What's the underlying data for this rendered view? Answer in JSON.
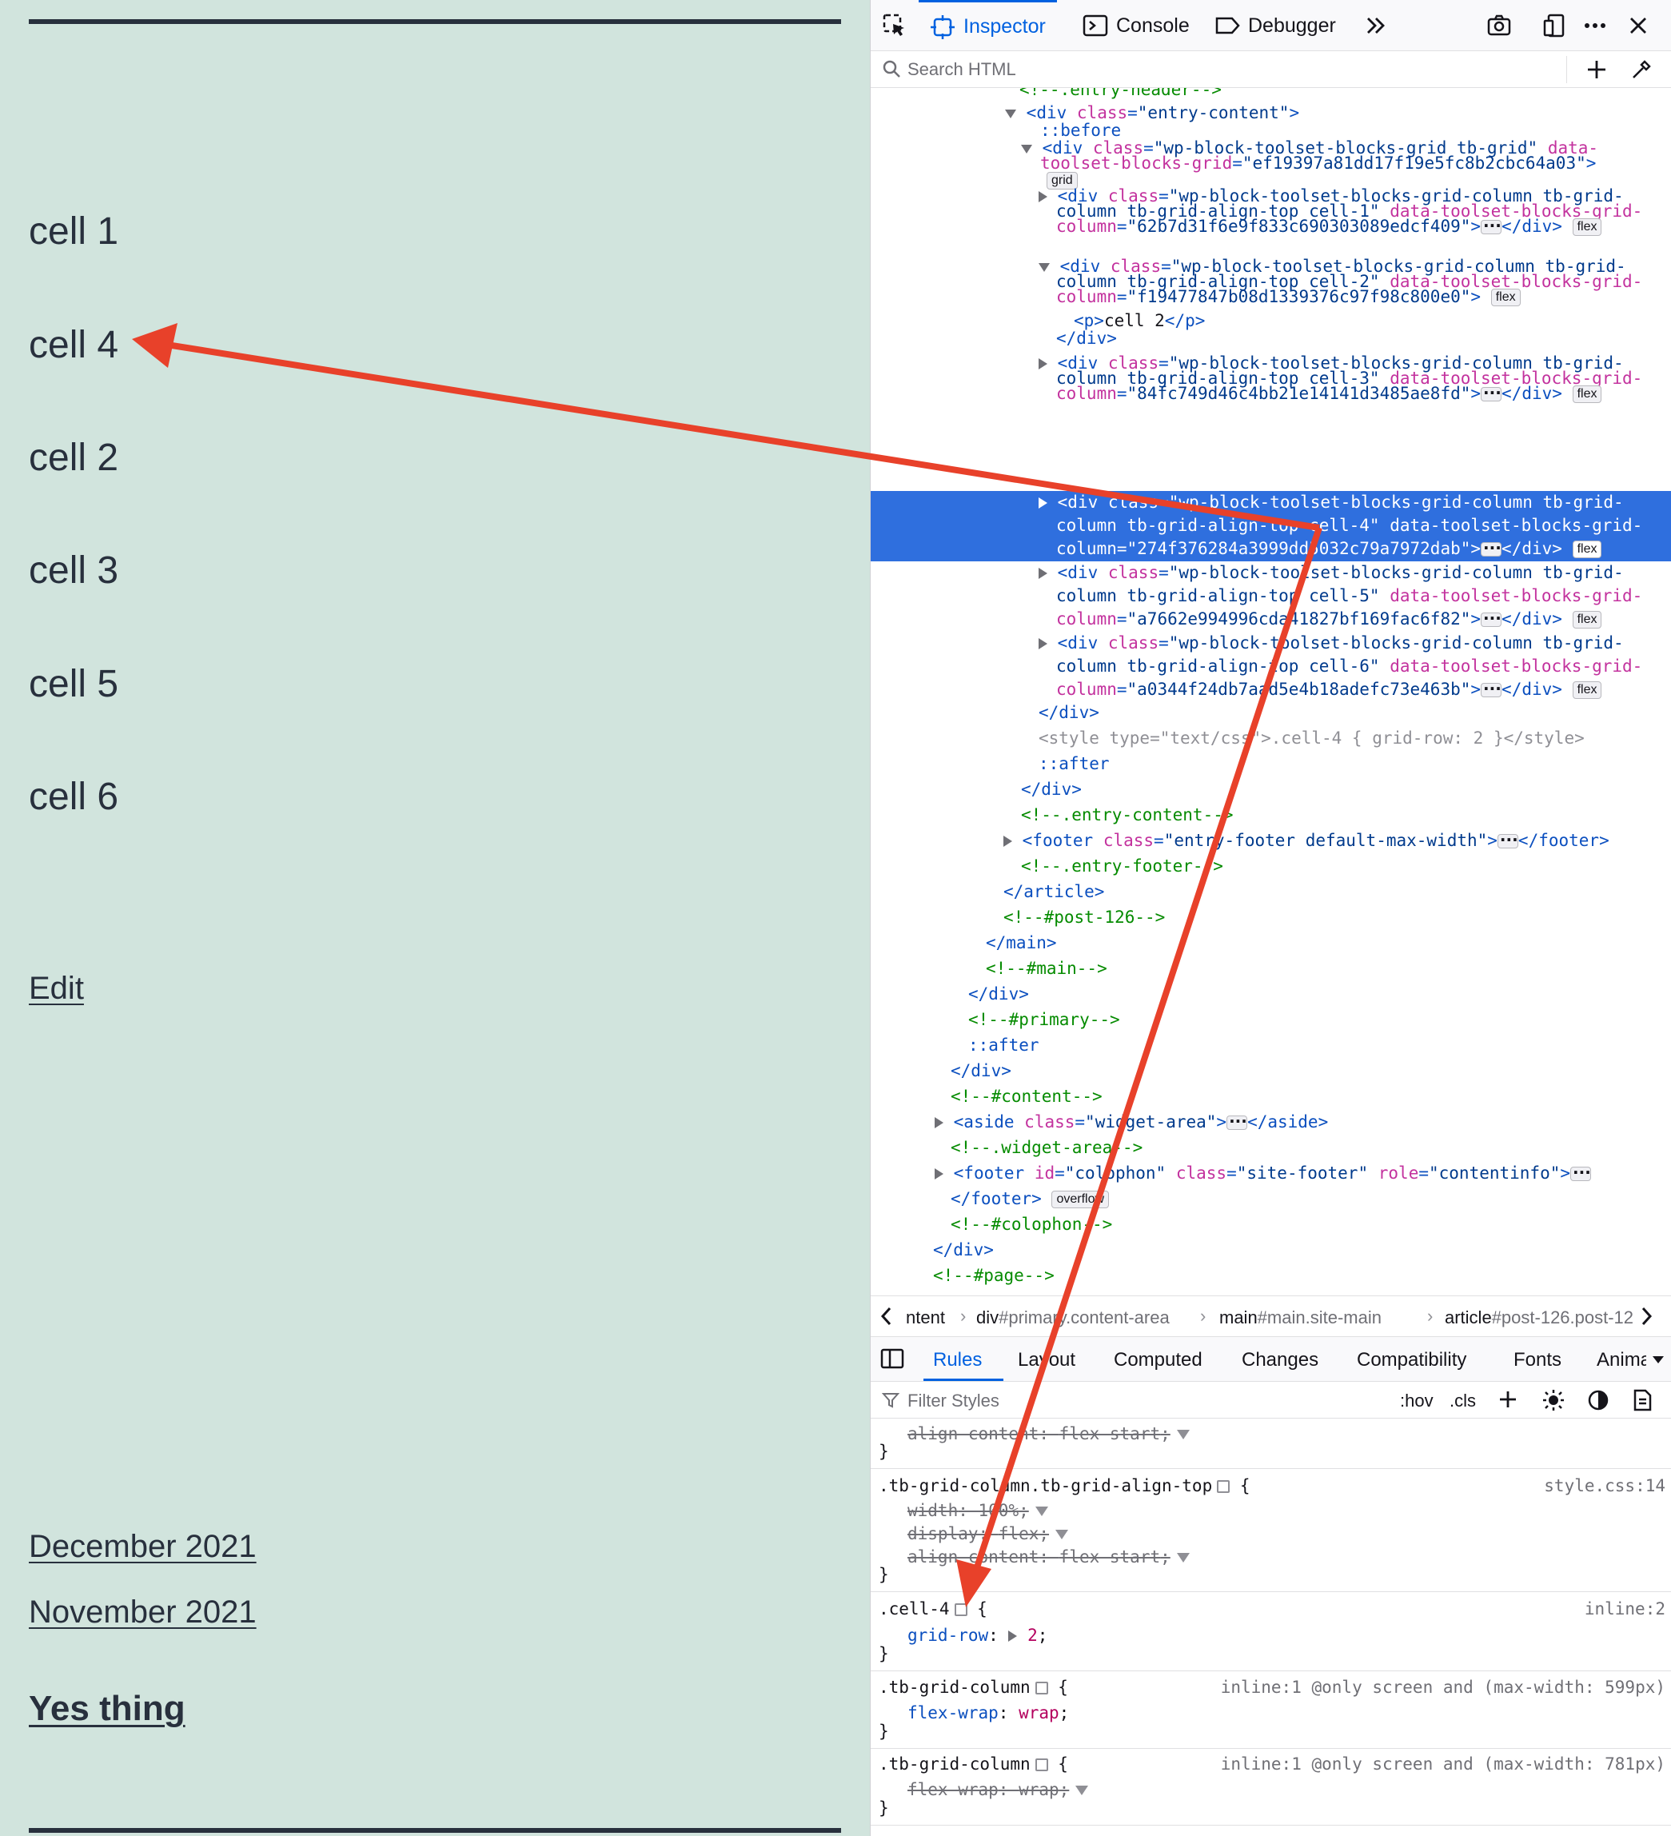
{
  "page": {
    "cells": [
      "cell 1",
      "cell 4",
      "cell 2",
      "cell 3",
      "cell 5",
      "cell 6"
    ],
    "edit_link": "Edit",
    "archives": [
      "December 2021",
      "November 2021"
    ],
    "widget_heading": "Yes thing"
  },
  "devtools": {
    "tabs": {
      "inspector": "Inspector",
      "console": "Console",
      "debugger": "Debugger"
    },
    "search_placeholder": "Search HTML",
    "tree": {
      "l0": "<!--.entry-header-->",
      "l1_tag": "div",
      "l1_attr": "class",
      "l1_val": "\"entry-content\"",
      "l2": "::before",
      "l3a": "\"wp-block-toolset-blocks-grid tb-grid\"",
      "l3b": "toolset-blocks-grid",
      "l3c": "\"ef19397a81dd17f19e5fc8b2cbc64a03\"",
      "badge_grid": "grid",
      "c1a": "\"wp-block-toolset-blocks-grid-column tb-grid-",
      "c1b": "column tb-grid-align-top cell-1\"",
      "c1c": "\"62b7d31f6e9f833c690303089edcf409\"",
      "c2b": "column tb-grid-align-top cell-2\"",
      "c2c": "\"f19477847b08d1339376c97f98c800e0\"",
      "p_text": "cell 2",
      "c3b": "column tb-grid-align-top cell-3\"",
      "c3c": "\"84fc749d46c4bb21e14141d3485ae8fd\"",
      "c4b": "column tb-grid-align-top cell-4\"",
      "c4c": "\"274f376284a3999dd5032c79a7972dab\"",
      "c5b": "column tb-grid-align-top cell-5\"",
      "c5c": "\"a7662e994996cda41827bf169fac6f82\"",
      "c6b": "column tb-grid-align-top cell-6\"",
      "c6c": "\"a0344f24db7aad5e4b18adefc73e463b\"",
      "data_attr_tail": "data-toolset-blocks-grid-",
      "data_attr_col": "column",
      "badge_flex": "flex",
      "style_line": "<style type=\"text/css\">.cell-4 { grid-row: 2 }</style>",
      "after": "::after",
      "cmt_entry_content": "<!--.entry-content-->",
      "footer_val": "\"entry-footer default-max-width\"",
      "cmt_entry_footer": "<!--.entry-footer-->",
      "cmt_post": "<!--#post-126-->",
      "cmt_main": "<!--#main-->",
      "cmt_primary": "<!--#primary-->",
      "cmt_content": "<!--#content-->",
      "aside_val": "\"widget-area\"",
      "cmt_widget": "<!--.widget-area-->",
      "colophon_id": "\"colophon\"",
      "colophon_class": "\"site-footer\"",
      "colophon_role": "\"contentinfo\"",
      "badge_overflow": "overflow",
      "cmt_colophon": "<!--#colophon-->",
      "cmt_page": "<!--#page-->"
    },
    "breadcrumbs": [
      {
        "tag": "ntent",
        "rest": ""
      },
      {
        "tag": "div",
        "rest": "#primary.content-area"
      },
      {
        "tag": "main",
        "rest": "#main.site-main"
      },
      {
        "tag": "article",
        "rest": "#post-126.post-12"
      }
    ],
    "rule_tabs": [
      "Rules",
      "Layout",
      "Computed",
      "Changes",
      "Compatibility",
      "Fonts",
      "Anima"
    ],
    "filter_placeholder": "Filter Styles",
    "filter_hov": ":hov",
    "filter_cls": ".cls",
    "rules": {
      "r0_prop": "align-content",
      "r0_val": "flex-start",
      "r1_sel": ".tb-grid-column.tb-grid-align-top",
      "r1_src": "style.css:14",
      "r1_p1": "width",
      "r1_v1": "100%",
      "r1_p2": "display",
      "r1_v2": "flex",
      "r1_p3": "align-content",
      "r1_v3": "flex-start",
      "r2_sel": ".cell-4",
      "r2_src": "inline:2",
      "r2_p1": "grid-row",
      "r2_v1": "2",
      "r3_sel": ".tb-grid-column",
      "r3_src": "inline:1 @only screen and (max-width: 599px)",
      "r3_p1": "flex-wrap",
      "r3_v1": "wrap",
      "r4_sel": ".tb-grid-column",
      "r4_src": "inline:1 @only screen and (max-width: 781px)",
      "r4_p1": "flex-wrap",
      "r4_v1": "wrap"
    }
  },
  "colors": {
    "page_bg": "#d1e4dd",
    "selection": "#2f6fde",
    "accent": "#0061e0",
    "annotation_arrow": "#e8412a"
  }
}
